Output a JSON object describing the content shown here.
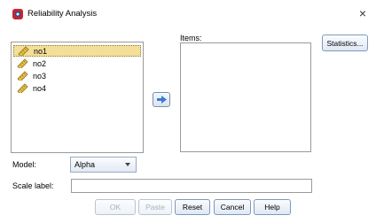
{
  "window": {
    "title": "Reliability Analysis",
    "close_glyph": "×",
    "app_icon": "spss-app-icon"
  },
  "variables": {
    "items": [
      {
        "label": "no1",
        "icon": "scale-variable-icon",
        "selected": true
      },
      {
        "label": "no2",
        "icon": "scale-variable-icon",
        "selected": false
      },
      {
        "label": "no3",
        "icon": "scale-variable-icon",
        "selected": false
      },
      {
        "label": "no4",
        "icon": "scale-variable-icon",
        "selected": false
      }
    ]
  },
  "move_button": {
    "icon": "arrow-right-icon"
  },
  "items_panel": {
    "label": "Items:"
  },
  "statistics_button": {
    "label": "Statistics..."
  },
  "model": {
    "label": "Model:",
    "value": "Alpha"
  },
  "scale_label": {
    "label": "Scale label:",
    "value": ""
  },
  "buttons": {
    "ok": "OK",
    "paste": "Paste",
    "reset": "Reset",
    "cancel": "Cancel",
    "help": "Help"
  },
  "colors": {
    "selection": "#f4df98",
    "arrow_button": "#3a7bd5",
    "button_border": "#8099b8"
  }
}
